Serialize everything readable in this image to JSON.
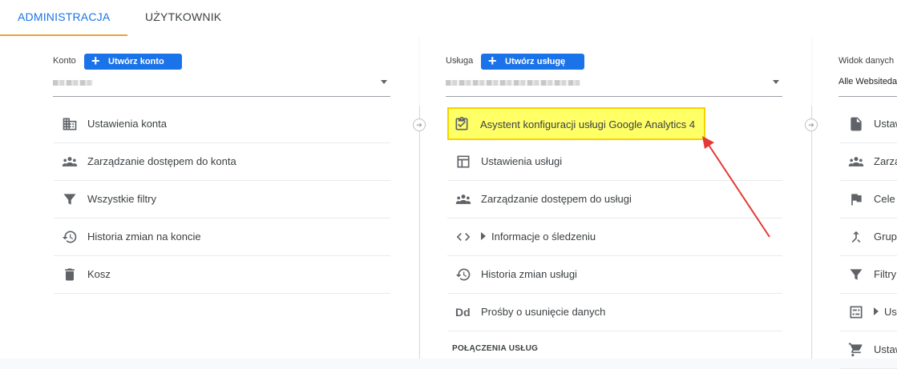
{
  "tabs": {
    "admin": "ADMINISTRACJA",
    "user": "UŻYTKOWNIK"
  },
  "account": {
    "label": "Konto",
    "create_label": "Utwórz konto",
    "items": [
      {
        "icon": "building-icon",
        "label": "Ustawienia konta"
      },
      {
        "icon": "people-icon",
        "label": "Zarządzanie dostępem do konta"
      },
      {
        "icon": "filter-icon",
        "label": "Wszystkie filtry"
      },
      {
        "icon": "history-icon",
        "label": "Historia zmian na koncie"
      },
      {
        "icon": "trash-icon",
        "label": "Kosz"
      }
    ]
  },
  "property": {
    "label": "Usługa",
    "create_label": "Utwórz usługę",
    "items": [
      {
        "icon": "clipboard-check-icon",
        "label": "Asystent konfiguracji usługi Google Analytics 4",
        "highlighted": true
      },
      {
        "icon": "layout-icon",
        "label": "Ustawienia usługi"
      },
      {
        "icon": "people-icon",
        "label": "Zarządzanie dostępem do usługi"
      },
      {
        "icon": "code-icon",
        "label": "Informacje o śledzeniu"
      },
      {
        "icon": "history-icon",
        "label": "Historia zmian usługi"
      },
      {
        "icon": "dd-icon",
        "label": "Prośby o usunięcie danych"
      }
    ],
    "section_title": "POŁĄCZENIA USŁUG"
  },
  "view": {
    "label": "Widok danych",
    "selected": "Alle Websitedaten",
    "items": [
      {
        "icon": "document-icon",
        "label": "Ustawienia widoku"
      },
      {
        "icon": "people-icon",
        "label": "Zarządzanie dostępem do widoku"
      },
      {
        "icon": "flag-icon",
        "label": "Cele"
      },
      {
        "icon": "merge-icon",
        "label": "Grupowanie treści"
      },
      {
        "icon": "filter-icon",
        "label": "Filtry"
      },
      {
        "icon": "channel-icon",
        "label": "Ustawienia kanału"
      },
      {
        "icon": "cart-icon",
        "label": "Ustawienia e-commerce"
      }
    ]
  },
  "annotation": {
    "color": "#e53935",
    "highlight": "#ffff66"
  }
}
